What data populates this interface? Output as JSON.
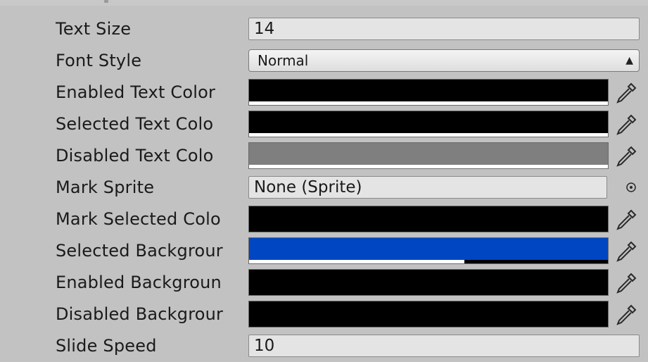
{
  "inspector": {
    "text_size": {
      "label": "Text Size",
      "value": "14"
    },
    "font_style": {
      "label": "Font Style",
      "value": "Normal"
    },
    "enabled_text_color": {
      "label": "Enabled Text Color",
      "color": "#000000",
      "alpha": 1.0
    },
    "selected_text_color": {
      "label": "Selected Text Colo",
      "color": "#000000",
      "alpha": 1.0
    },
    "disabled_text_color": {
      "label": "Disabled Text Colo",
      "color": "#7f7f7f",
      "alpha": 1.0
    },
    "mark_sprite": {
      "label": "Mark Sprite",
      "value": "None (Sprite)"
    },
    "mark_selected_color": {
      "label": "Mark Selected Colo",
      "color": "#000000",
      "alpha": 0.0
    },
    "selected_background": {
      "label": "Selected Backgrour",
      "color": "#0046c2",
      "alpha": 0.6
    },
    "enabled_background": {
      "label": "Enabled Backgroun",
      "color": "#000000",
      "alpha": 0.0
    },
    "disabled_background": {
      "label": "Disabled Backgrour",
      "color": "#000000",
      "alpha": 0.0
    },
    "slide_speed": {
      "label": "Slide Speed",
      "value": "10"
    }
  },
  "icons": {
    "picker": "eyedropper-icon",
    "object_picker": "object-picker-icon",
    "dropdown_arrow": "dropdown-arrow-icon"
  }
}
